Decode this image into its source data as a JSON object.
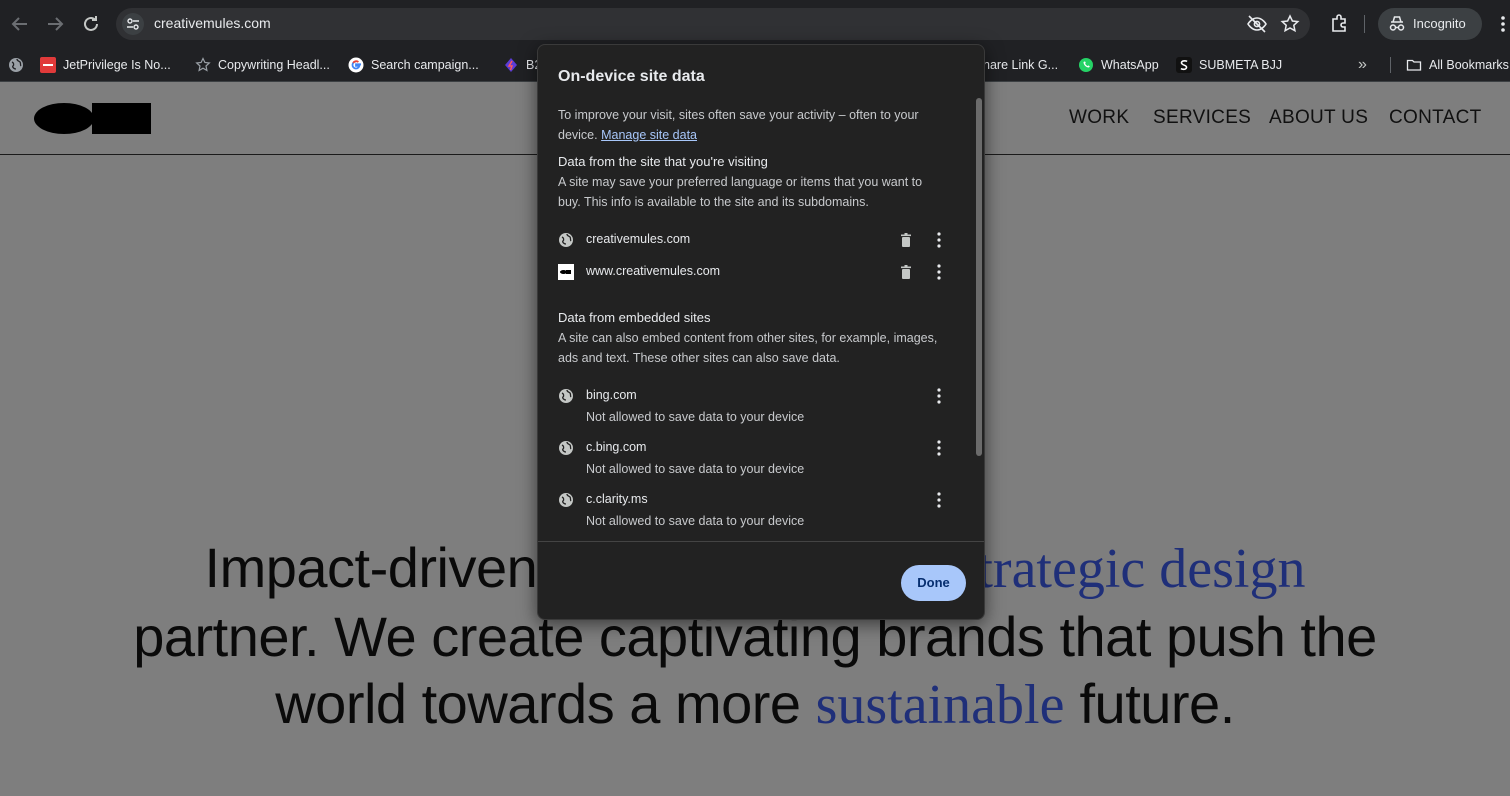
{
  "browser": {
    "url": "creativemules.com",
    "profile_label": "Incognito",
    "bookmarks": [
      {
        "label": "JetPrivilege Is No...",
        "icon": "jetprivilege-icon"
      },
      {
        "label": "Copywriting Headl...",
        "icon": "star-icon"
      },
      {
        "label": "Search campaign...",
        "icon": "google-icon"
      },
      {
        "label": "B2",
        "icon": "b2-icon"
      },
      {
        "label": "hare Link G...",
        "icon": "partial-bookmark"
      },
      {
        "label": "WhatsApp",
        "icon": "whatsapp-icon"
      },
      {
        "label": "SUBMETA BJJ",
        "icon": "submeta-icon"
      }
    ],
    "all_bookmarks_label": "All Bookmarks",
    "overflow_label": "»"
  },
  "site": {
    "nav": [
      "WORK",
      "SERVICES",
      "ABOUT US",
      "CONTACT"
    ],
    "hero": {
      "part1": "Impact-driven t",
      "highlight1": "trategic design",
      "part2": "partner. We create captivating brands that push the world towards a more ",
      "highlight2": "sustainable",
      "part3": " future."
    }
  },
  "dialog": {
    "title": "On-device site data",
    "intro": "To improve your visit, sites often save your activity – often to your device. ",
    "intro_link": "Manage site data",
    "section1": {
      "title": "Data from the site that you're visiting",
      "description": "A site may save your preferred language or items that you want to buy. This info is available to the site and its subdomains.",
      "sites": [
        {
          "name": "creativemules.com"
        },
        {
          "name": "www.creativemules.com"
        }
      ]
    },
    "section2": {
      "title": "Data from embedded sites",
      "description": "A site can also embed content from other sites, for example, images, ads and text. These other sites can also save data.",
      "sites": [
        {
          "name": "bing.com",
          "status": "Not allowed to save data to your device"
        },
        {
          "name": "c.bing.com",
          "status": "Not allowed to save data to your device"
        },
        {
          "name": "c.clarity.ms",
          "status": "Not allowed to save data to your device"
        }
      ]
    },
    "done_label": "Done"
  },
  "colors": {
    "chrome_bg": "#202124",
    "dialog_bg": "#222222",
    "accent": "#a8c7fa",
    "hero_highlight": "#1f2f79"
  }
}
